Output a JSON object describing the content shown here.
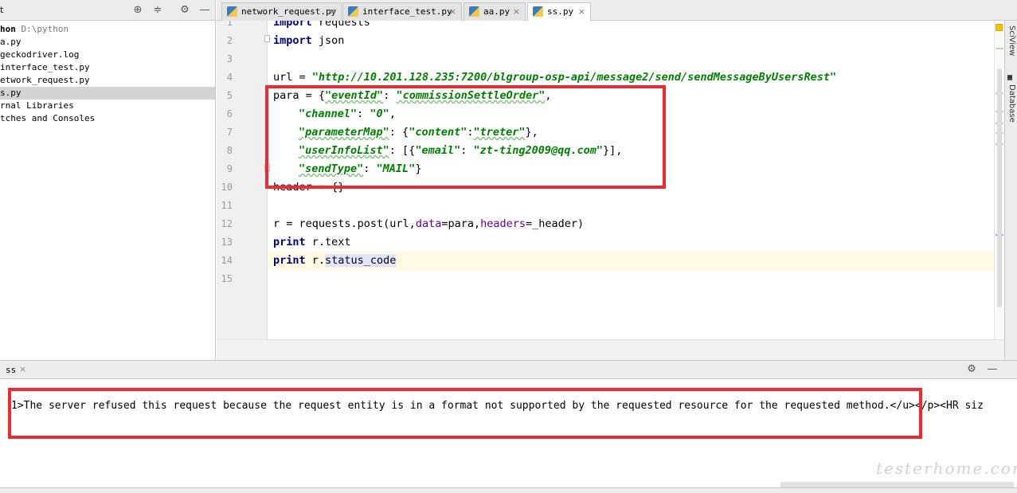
{
  "project_tree": {
    "header_label": "t",
    "items": [
      {
        "label": "hon",
        "muted": "D:\\python"
      },
      {
        "label": "a.py"
      },
      {
        "label": "geckodriver.log"
      },
      {
        "label": "interface_test.py"
      },
      {
        "label": "etwork_request.py"
      },
      {
        "label": "s.py"
      },
      {
        "label": "rnal Libraries"
      },
      {
        "label": "tches and Consoles"
      }
    ]
  },
  "tabs": [
    {
      "label": "network_request.py"
    },
    {
      "label": "interface_test.py"
    },
    {
      "label": "aa.py"
    },
    {
      "label": "ss.py",
      "active": true
    }
  ],
  "tab_close_glyph": "×",
  "line_numbers": [
    "1",
    "2",
    "3",
    "4",
    "5",
    "6",
    "7",
    "8",
    "9",
    "10",
    "11",
    "12",
    "13",
    "14",
    "15"
  ],
  "code": {
    "l1_kw": "import",
    "l1_rest": " requests",
    "l2_kw": "import",
    "l2_rest": " json",
    "l4_a": "url = ",
    "l4_str": "\"http://10.201.128.235:7200/blgroup-osp-api/message2/send/sendMessageByUsersRest\"",
    "l5_a": "para = {",
    "l5_k": "\"eventId\"",
    "l5_b": ": ",
    "l5_v": "\"commissionSettleOrder\"",
    "l5_c": ",",
    "l6_k": "\"channel\"",
    "l6_b": ": ",
    "l6_v": "\"0\"",
    "l6_c": ",",
    "l7_k": "\"parameterMap\"",
    "l7_b": ": {",
    "l7_k2": "\"content\"",
    "l7_c": ":",
    "l7_v": "\"treter\"",
    "l7_d": "},",
    "l8_k": "\"userInfoList\"",
    "l8_b": ": [{",
    "l8_k2": "\"email\"",
    "l8_c": ": ",
    "l8_v": "\"zt-ting2009@qq.com\"",
    "l8_d": "}],",
    "l9_k": "\"sendType\"",
    "l9_b": ": ",
    "l9_v": "\"MAIL\"",
    "l9_c": "}",
    "l10": "header = {}",
    "l12_a": "r = requests.post(url,",
    "l12_p1": "data",
    "l12_b": "=para,",
    "l12_p2": "headers",
    "l12_c": "=_header)",
    "l13_kw": "print",
    "l13_rest": " r.text",
    "l14_kw": "print",
    "l14_a": " r.",
    "l14_b": "status_code"
  },
  "side_tools": [
    "SciView",
    "Database"
  ],
  "run_panel": {
    "tab_label": "ss",
    "output": "1>The server refused this request because the request entity is in a format not supported by the requested resource for the requested method.</u></p><HR siz"
  },
  "watermark": "testerhome.com"
}
